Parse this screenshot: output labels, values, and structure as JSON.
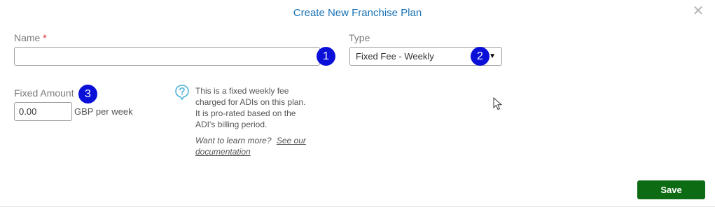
{
  "modal": {
    "title": "Create New Franchise Plan",
    "close_glyph": "✕"
  },
  "name_field": {
    "label": "Name",
    "required_marker": "*",
    "value": "",
    "badge": "1"
  },
  "type_field": {
    "label": "Type",
    "selected": "Fixed Fee - Weekly",
    "caret": "▼",
    "badge": "2"
  },
  "fixed_amount": {
    "label": "Fixed Amount",
    "value": "0.00",
    "unit": "GBP per week",
    "badge": "3"
  },
  "info": {
    "icon": "question-bubble-icon",
    "lines": [
      "This is a fixed weekly fee",
      "charged for ADIs on this plan.",
      "It is pro-rated based on the",
      "ADI's billing period."
    ],
    "learn_prefix": "Want to learn more?",
    "link_line1": "See our",
    "link_line2": "documentation"
  },
  "footer": {
    "save_label": "Save"
  },
  "colors": {
    "title": "#1a73b5",
    "badge": "#0a10d8",
    "save": "#0d6b14",
    "info_icon": "#4fb3d9",
    "required": "#d9262b"
  }
}
